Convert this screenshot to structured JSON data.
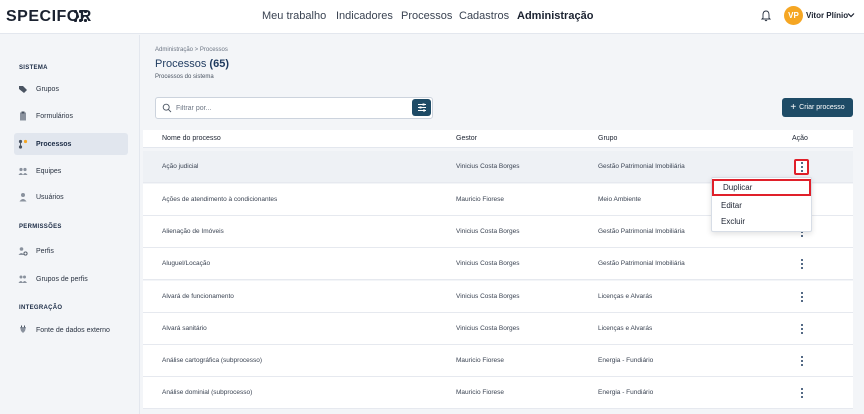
{
  "app": {
    "logo": "SPECIFOR"
  },
  "topnav": {
    "items": [
      "Meu trabalho",
      "Indicadores",
      "Processos",
      "Cadastros",
      "Administração"
    ],
    "active": "Administração"
  },
  "user": {
    "initials": "VP",
    "name": "Vitor Plínio",
    "avatar_color": "#f5a623"
  },
  "sidebar": {
    "sections": [
      {
        "title": "SISTEMA",
        "items": [
          {
            "label": "Grupos",
            "icon": "tag-icon"
          },
          {
            "label": "Formulários",
            "icon": "clipboard-icon"
          },
          {
            "label": "Processos",
            "icon": "flow-icon",
            "active": true
          },
          {
            "label": "Equipes",
            "icon": "team-icon"
          },
          {
            "label": "Usuários",
            "icon": "user-icon"
          }
        ]
      },
      {
        "title": "PERMISSÕES",
        "items": [
          {
            "label": "Perfis",
            "icon": "profile-gear-icon"
          },
          {
            "label": "Grupos de perfis",
            "icon": "profile-group-icon"
          }
        ]
      },
      {
        "title": "INTEGRAÇÃO",
        "items": [
          {
            "label": "Fonte de dados externo",
            "icon": "plug-icon"
          }
        ]
      }
    ]
  },
  "page": {
    "breadcrumb": "Administração  >  Processos",
    "title": "Processos",
    "count": "(65)",
    "subtitle": "Processos do sistema",
    "search_placeholder": "Filtrar por...",
    "create_label": "Criar processo"
  },
  "table": {
    "headers": [
      "Nome do processo",
      "Gestor",
      "Grupo",
      "Ação"
    ],
    "rows": [
      [
        "Ação judicial",
        "Vinicius Costa Borges",
        "Gestão Patrimonial Imobiliária"
      ],
      [
        "Ações de atendimento à condicionantes",
        "Mauricio Fiorese",
        "Meio Ambiente"
      ],
      [
        "Alienação de Imóveis",
        "Vinicius Costa Borges",
        "Gestão Patrimonial Imobiliária"
      ],
      [
        "Aluguel/Locação",
        "Vinicius Costa Borges",
        "Gestão Patrimonial Imobiliária"
      ],
      [
        "Alvará de funcionamento",
        "Vinicius Costa Borges",
        "Licenças e Alvarás"
      ],
      [
        "Alvará sanitário",
        "Vinicius Costa Borges",
        "Licenças e Alvarás"
      ],
      [
        "Análise cartográfica (subprocesso)",
        "Mauricio Fiorese",
        "Energia - Fundiário"
      ],
      [
        "Análise dominial (subprocesso)",
        "Mauricio Fiorese",
        "Energia - Fundiário"
      ]
    ]
  },
  "row_menu": {
    "items": [
      "Duplicar",
      "Editar",
      "Excluir"
    ],
    "highlighted": "Duplicar",
    "highlight_color": "#e0202a"
  }
}
